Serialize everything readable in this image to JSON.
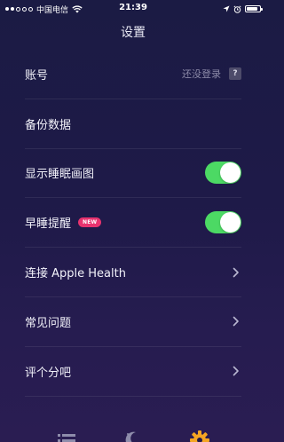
{
  "status_bar": {
    "carrier": "中国电信",
    "time": "21:39",
    "battery_level": 0.85
  },
  "nav": {
    "title": "设置"
  },
  "settings": {
    "account": {
      "label": "账号",
      "status": "还没登录",
      "help": "?"
    },
    "backup": {
      "label": "备份数据"
    },
    "show_sleep_chart": {
      "label": "显示睡眠画图",
      "enabled": true
    },
    "early_sleep_reminder": {
      "label": "早睡提醒",
      "badge": "NEW",
      "enabled": true
    },
    "apple_health": {
      "label": "连接 Apple Health"
    },
    "faq": {
      "label": "常见问题"
    },
    "rate": {
      "label": "评个分吧"
    }
  },
  "tab_bar": {
    "tabs": [
      {
        "icon": "list-icon",
        "active": false
      },
      {
        "icon": "moon-icon",
        "active": false
      },
      {
        "icon": "gear-icon",
        "active": true
      }
    ]
  },
  "colors": {
    "background_top": "#1b1b44",
    "background_bottom": "#2a1d52",
    "toggle_on": "#4cd964",
    "badge": "#e8336f",
    "active_tab": "#f5a623"
  }
}
